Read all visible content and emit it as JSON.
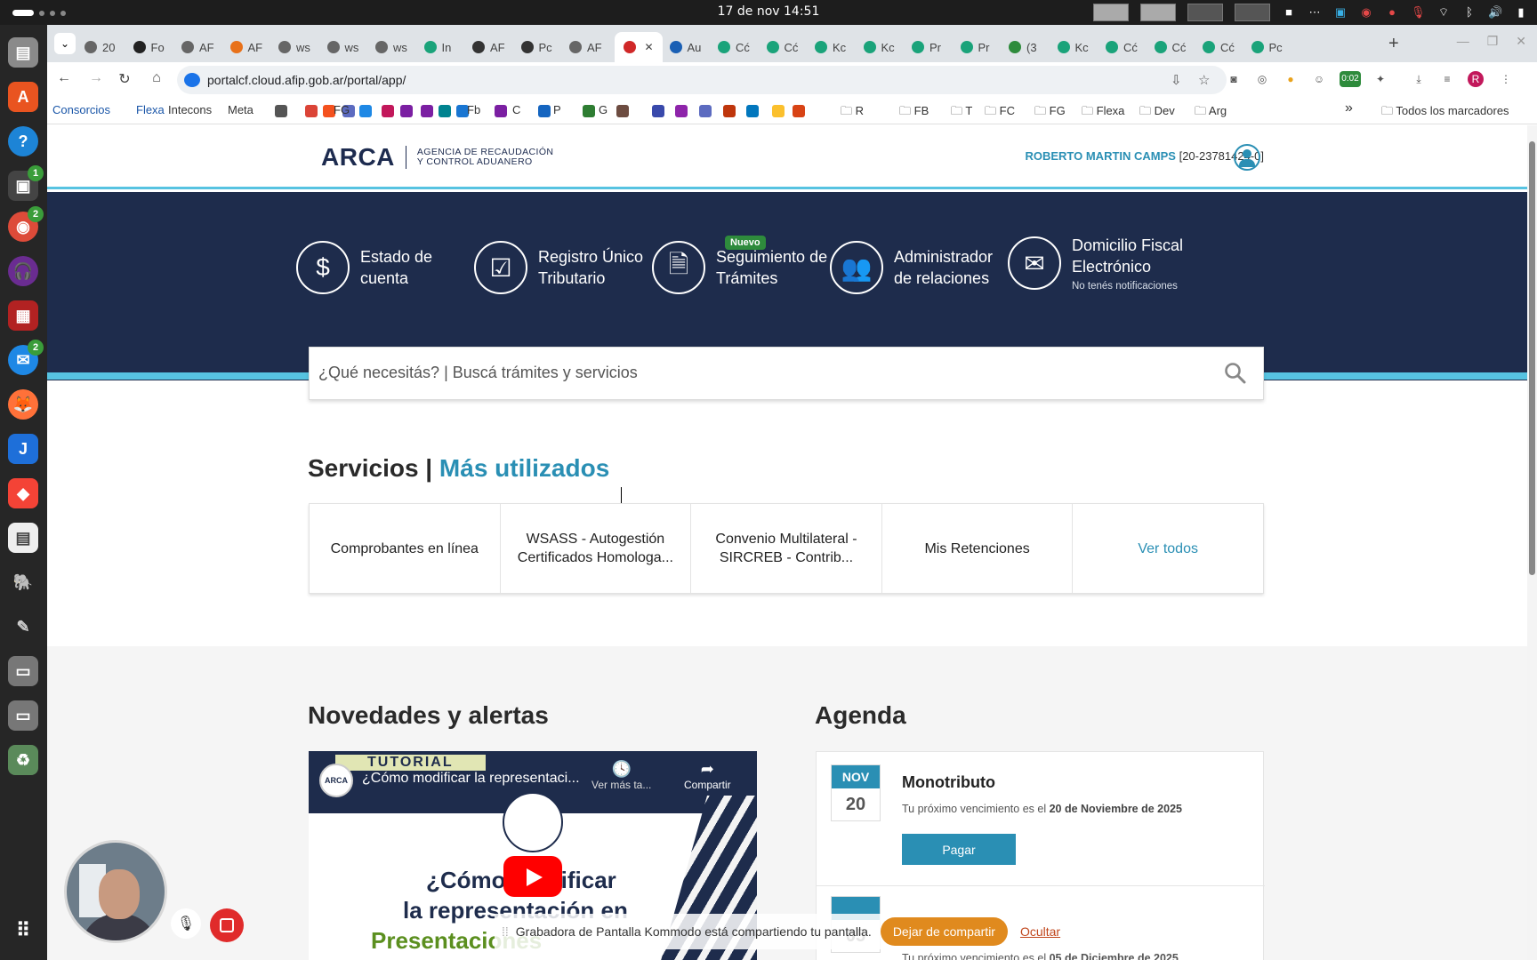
{
  "system": {
    "clock": "17 de nov  14:51",
    "recording_time": "0:02"
  },
  "browser": {
    "url": "portalcf.cloud.afip.gob.ar/portal/app/",
    "tabs": [
      {
        "label": "20",
        "color": "#666"
      },
      {
        "label": "Fo",
        "color": "#222"
      },
      {
        "label": "AF",
        "color": "#666"
      },
      {
        "label": "AF",
        "color": "#e8711a"
      },
      {
        "label": "ws",
        "color": "#666"
      },
      {
        "label": "ws",
        "color": "#666"
      },
      {
        "label": "ws",
        "color": "#666"
      },
      {
        "label": "In",
        "color": "#1aa37a"
      },
      {
        "label": "AF",
        "color": "#333"
      },
      {
        "label": "Pc",
        "color": "#333"
      },
      {
        "label": "AF",
        "color": "#666"
      },
      {
        "label": "",
        "color": "#d02828",
        "active": true
      },
      {
        "label": "Au",
        "color": "#1a5fb4"
      },
      {
        "label": "Cć",
        "color": "#1aa37a"
      },
      {
        "label": "Cć",
        "color": "#1aa37a"
      },
      {
        "label": "Kc",
        "color": "#1aa37a"
      },
      {
        "label": "Kc",
        "color": "#1aa37a"
      },
      {
        "label": "Pr",
        "color": "#1aa37a"
      },
      {
        "label": "Pr",
        "color": "#1aa37a"
      },
      {
        "label": "(3",
        "color": "#2e8b3c"
      },
      {
        "label": "Kc",
        "color": "#1aa37a"
      },
      {
        "label": "Cć",
        "color": "#1aa37a"
      },
      {
        "label": "Cć",
        "color": "#1aa37a"
      },
      {
        "label": "Cć",
        "color": "#1aa37a"
      },
      {
        "label": "Pc",
        "color": "#1aa37a"
      }
    ],
    "bookmarks": [
      {
        "label": "Consorcios",
        "blue": true
      },
      {
        "label": "Flexa",
        "blue": true
      },
      {
        "label": "Intecons"
      },
      {
        "label": "Meta"
      },
      {
        "label": "FG"
      },
      {
        "label": "Fb"
      },
      {
        "label": "C"
      },
      {
        "label": "P"
      },
      {
        "label": "G"
      },
      {
        "label": "R"
      },
      {
        "label": "FB"
      },
      {
        "label": "T"
      },
      {
        "label": "FC"
      },
      {
        "label": "FG"
      },
      {
        "label": "Flexa"
      },
      {
        "label": "Dev"
      },
      {
        "label": "Arg"
      }
    ],
    "all_bookmarks": "Todos los marcadores",
    "avatar_letter": "R"
  },
  "header": {
    "logo": "ARCA",
    "agency_line1": "AGENCIA DE RECAUDACIÓN",
    "agency_line2": "Y CONTROL ADUANERO",
    "user_name": "ROBERTO MARTIN CAMPS",
    "user_cuit": "[20-23781424-0]"
  },
  "quick_links": [
    {
      "line1": "Estado de",
      "line2": "cuenta",
      "icon": "dollar-icon",
      "glyph": "$"
    },
    {
      "line1": "Registro Único",
      "line2": "Tributario",
      "icon": "checkbox-icon",
      "glyph": "☑"
    },
    {
      "line1": "Seguimiento de",
      "line2": "Trámites",
      "icon": "document-icon",
      "glyph": "🗎",
      "badge": "Nuevo"
    },
    {
      "line1": "Administrador",
      "line2": "de relaciones",
      "icon": "users-icon",
      "glyph": "👥"
    },
    {
      "line1": "Domicilio Fiscal",
      "line2": "Electrónico",
      "icon": "envelope-icon",
      "glyph": "✉",
      "sub": "No tenés notificaciones"
    }
  ],
  "search": {
    "placeholder": "¿Qué necesitás? | Buscá trámites y servicios"
  },
  "services": {
    "title": "Servicios |",
    "title_accent": "Más utilizados",
    "items": [
      "Comprobantes en línea",
      "WSASS - Autogestión Certificados Homologa...",
      "Convenio Multilateral - SIRCREB - Contrib...",
      "Mis Retenciones",
      "Ver todos"
    ]
  },
  "news": {
    "title": "Novedades y alertas",
    "video": {
      "channel": "ARCA",
      "badge": "TUTORIAL",
      "title": "¿Cómo modificar la representaci...",
      "watch_later": "Ver más ta...",
      "share": "Compartir",
      "line1": "¿Cómo modificar",
      "line2": "la representación en",
      "line3": "Presentaciones"
    }
  },
  "agenda": {
    "title": "Agenda",
    "items": [
      {
        "month": "NOV",
        "day": "20",
        "title": "Monotributo",
        "text": "Tu próximo vencimiento es el",
        "date": "20 de Noviembre de 2025",
        "action": "Pagar"
      },
      {
        "month": "",
        "day": "05",
        "text": "Tu próximo vencimiento es el",
        "date": "05 de Diciembre de 2025"
      }
    ]
  },
  "screen_share": {
    "message": "Grabadora de Pantalla Kommodo está compartiendo tu pantalla.",
    "stop": "Dejar de compartir",
    "hide": "Ocultar"
  }
}
